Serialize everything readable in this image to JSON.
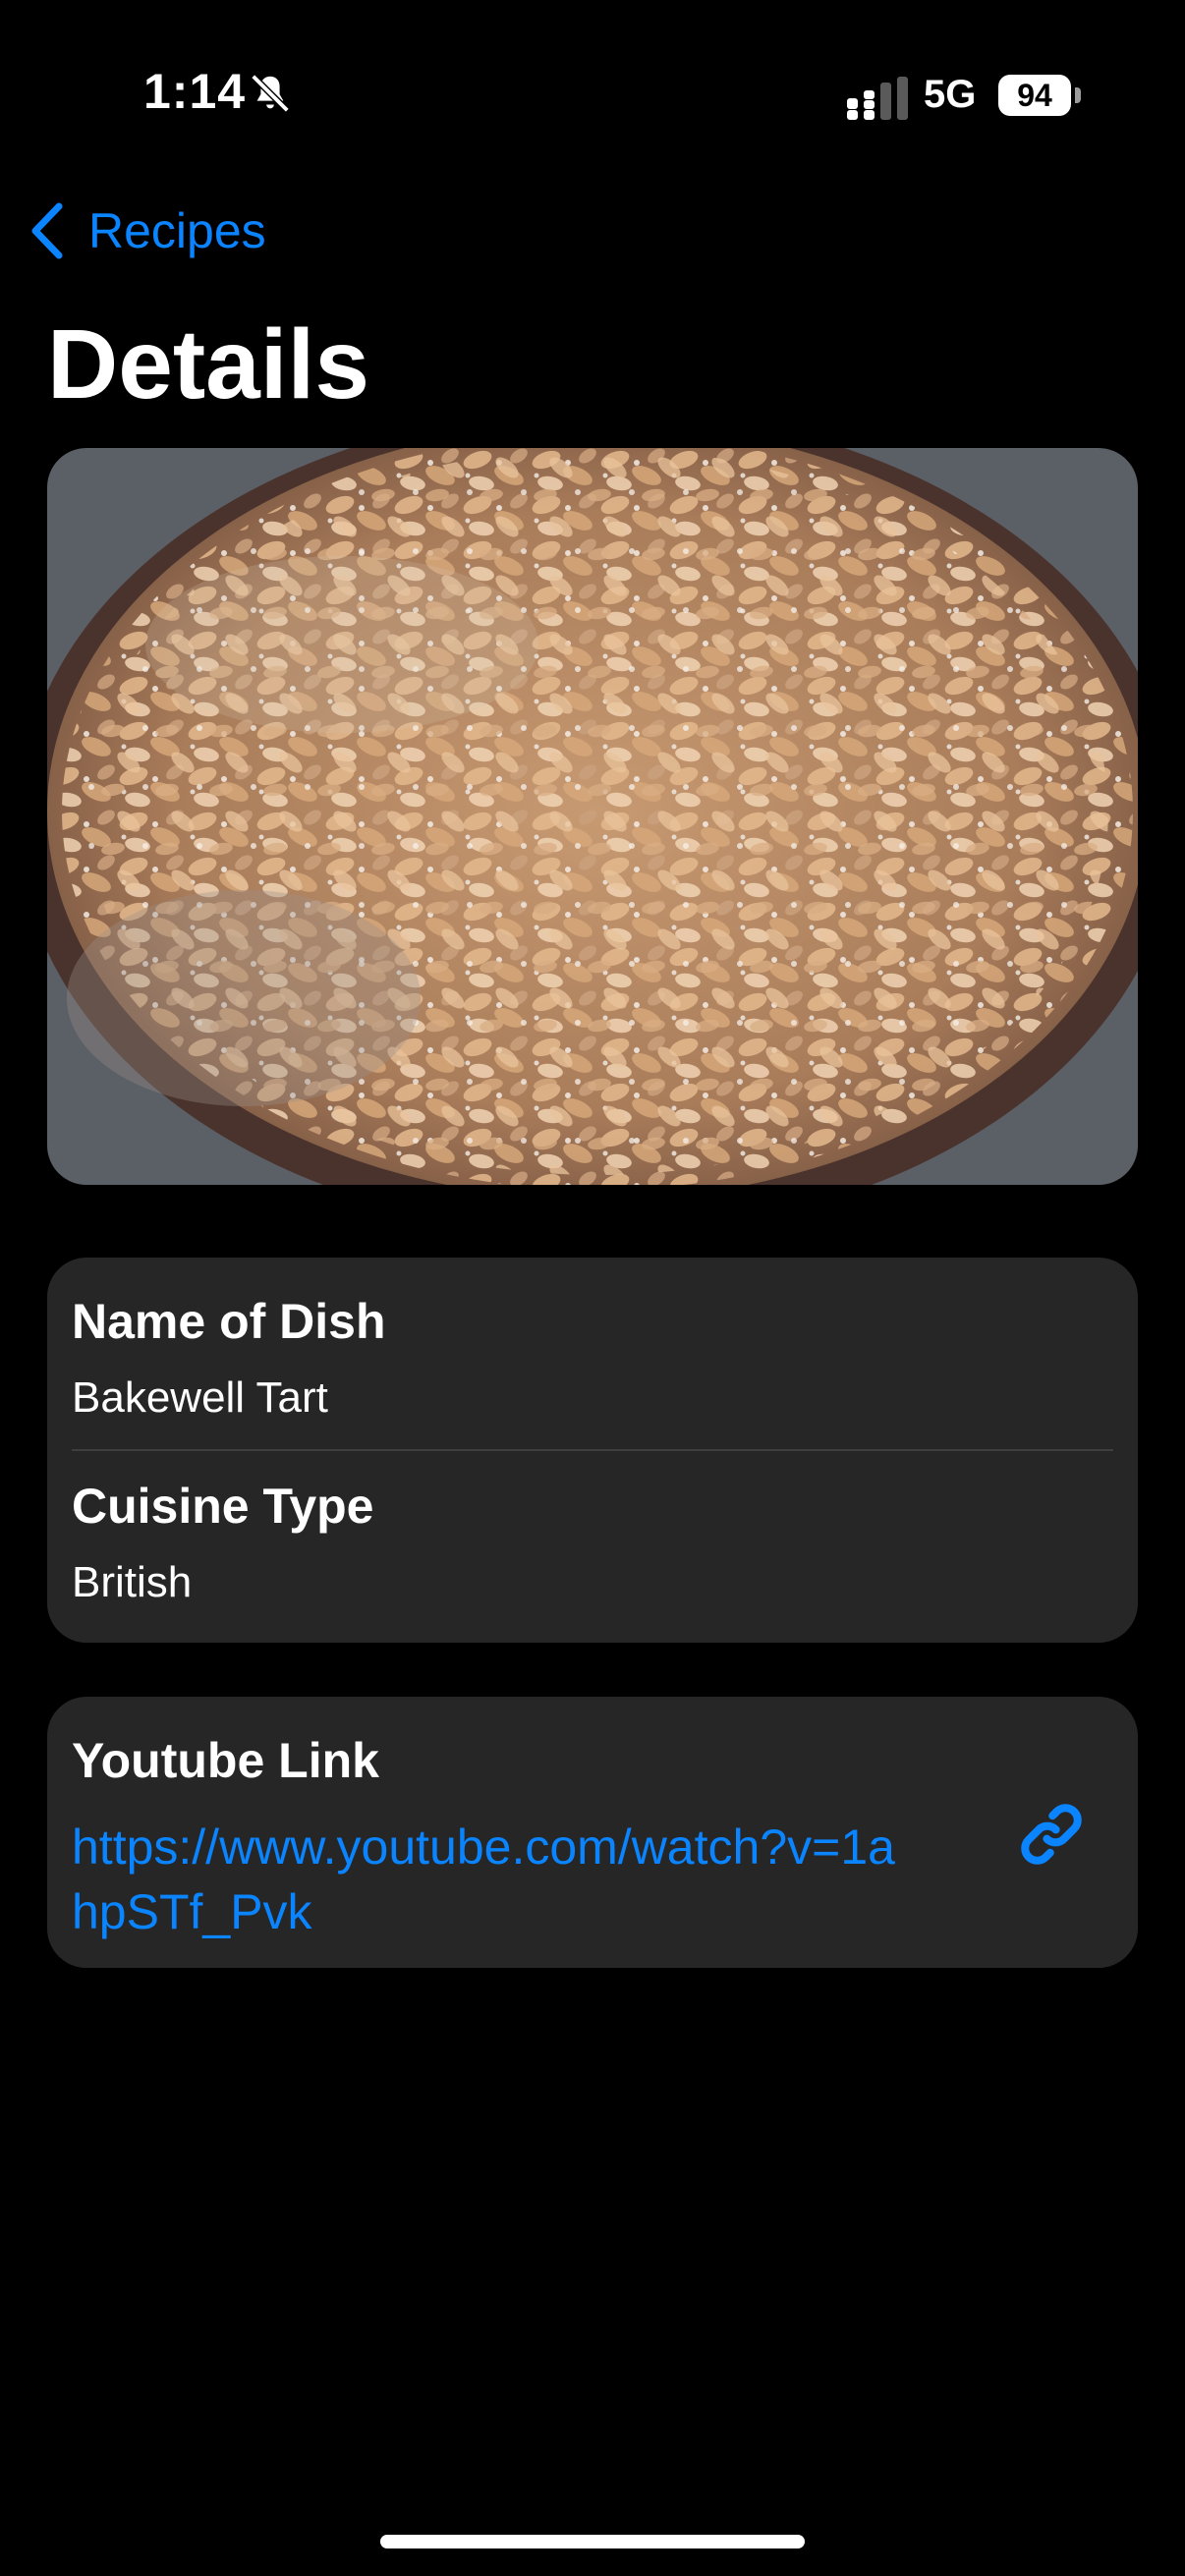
{
  "status_bar": {
    "time": "1:14",
    "network": "5G",
    "battery": "94"
  },
  "nav": {
    "back_label": "Recipes",
    "title": "Details"
  },
  "photo": {
    "icon": "recipe-photo"
  },
  "details": {
    "name_label": "Name of Dish",
    "name_value": "Bakewell Tart",
    "cuisine_label": "Cuisine Type",
    "cuisine_value": "British"
  },
  "youtube": {
    "label": "Youtube Link",
    "url": "https://www.youtube.com/watch?v=1ahpSTf_Pvk",
    "icon": "link-icon"
  },
  "colors": {
    "accent": "#0a84ff",
    "card": "#262626",
    "background": "#000000"
  }
}
